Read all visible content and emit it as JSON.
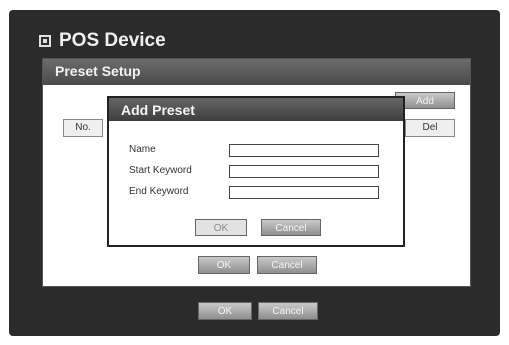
{
  "window": {
    "title": "POS Device"
  },
  "preset_setup": {
    "title": "Preset Setup",
    "add_label": "Add",
    "del_label": "Del",
    "no_header": "No.",
    "ok_label": "OK",
    "cancel_label": "Cancel"
  },
  "dialog": {
    "title": "Add Preset",
    "fields": [
      {
        "label": "Name",
        "value": ""
      },
      {
        "label": "Start Keyword",
        "value": ""
      },
      {
        "label": "End Keyword",
        "value": ""
      }
    ],
    "ok_label": "OK",
    "cancel_label": "Cancel"
  },
  "footer": {
    "ok_label": "OK",
    "cancel_label": "Cancel"
  }
}
